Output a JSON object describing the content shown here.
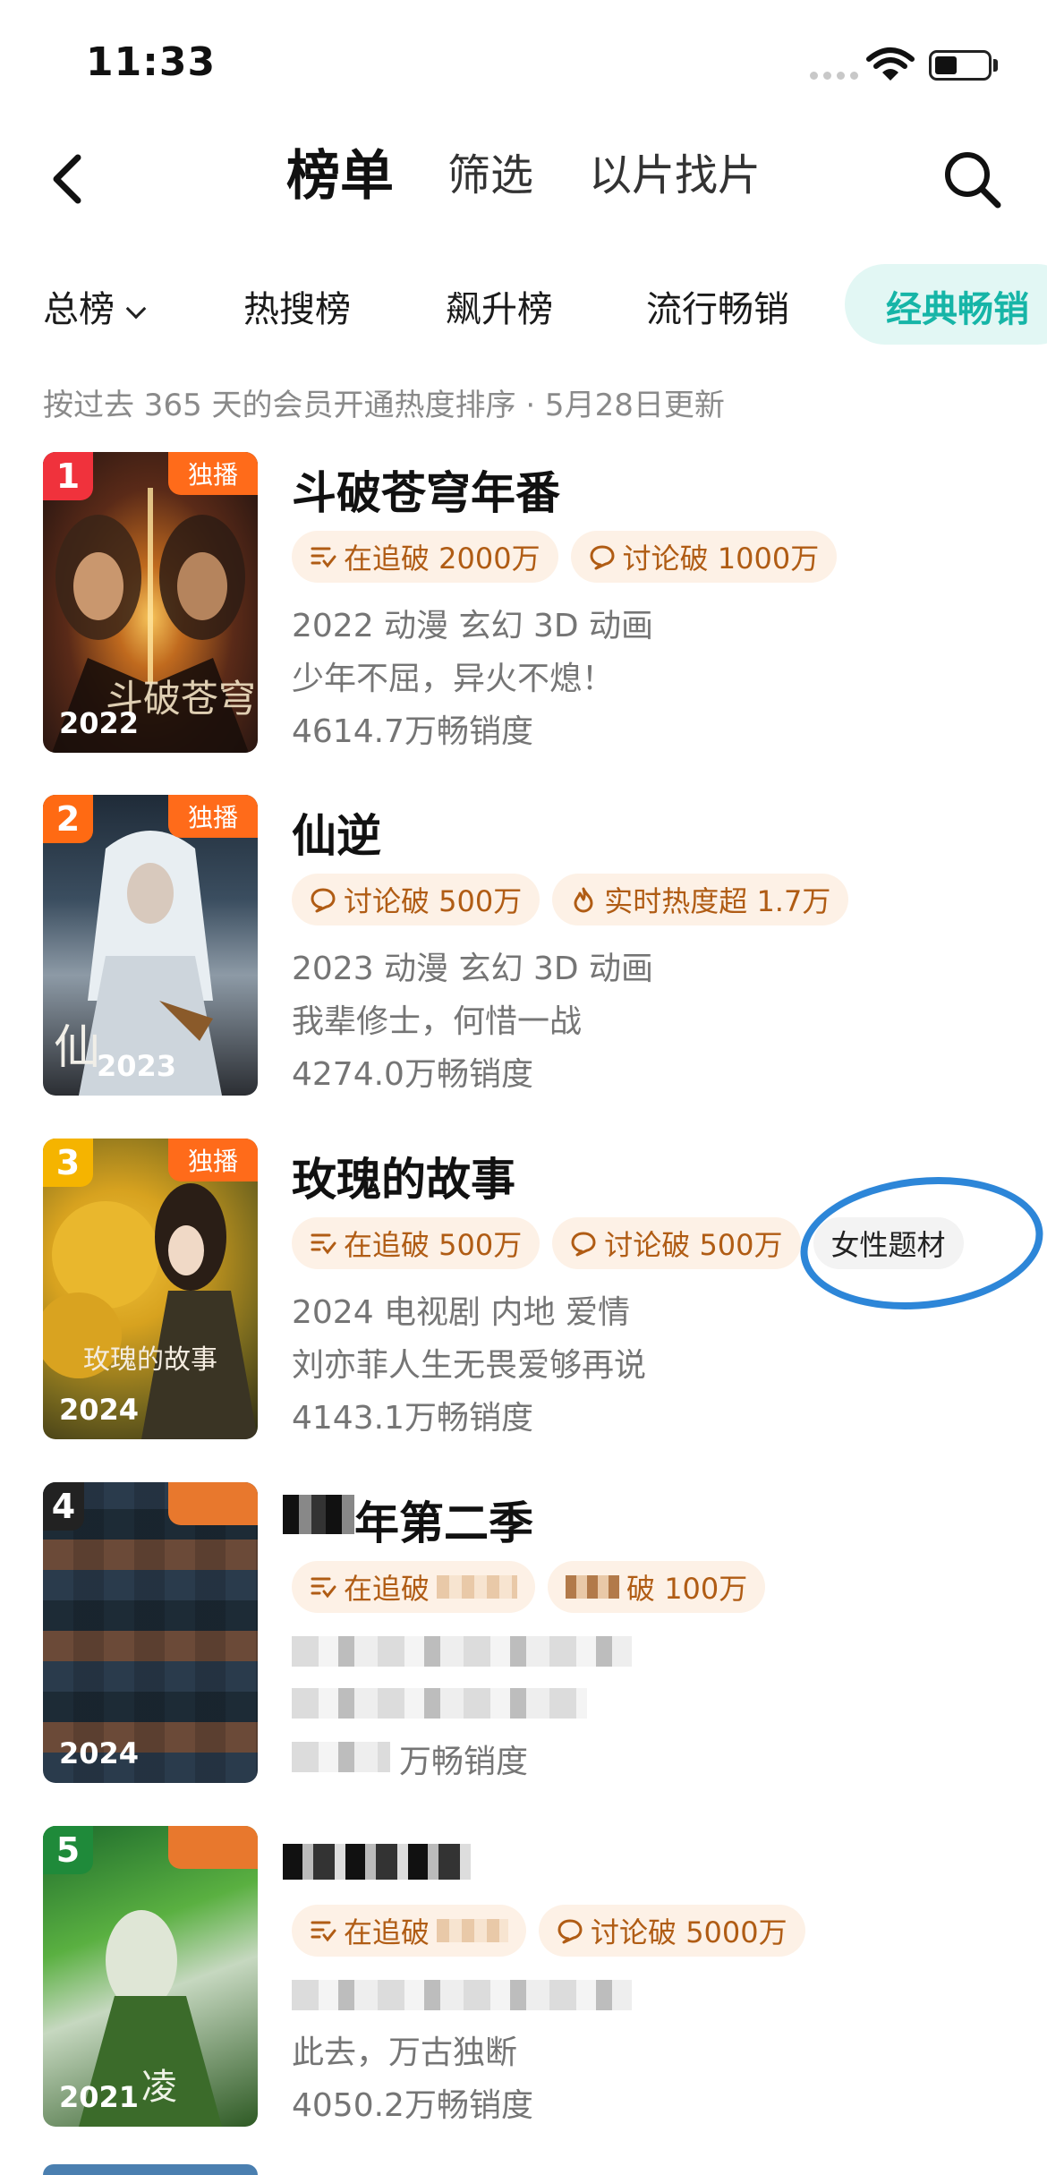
{
  "status_bar": {
    "time": "11:33"
  },
  "nav": {
    "tabs": [
      "榜单",
      "筛选",
      "以片找片"
    ]
  },
  "categories": {
    "items": [
      "总榜",
      "热搜榜",
      "飙升榜",
      "流行畅销"
    ],
    "active": "经典畅销"
  },
  "notice": "按过去 365 天的会员开通热度排序 · 5月28日更新",
  "items": [
    {
      "rank": "1",
      "badge": "独播",
      "poster_year": "2022",
      "title": "斗破苍穹年番",
      "tags": [
        {
          "icon": "following-icon",
          "label": "在追破 2000万"
        },
        {
          "icon": "comment-icon",
          "label": "讨论破 1000万"
        }
      ],
      "info": "2022 动漫 玄幻 3D 动画",
      "tagline": "少年不屈，异火不熄！",
      "sales": "4614.7万畅销度"
    },
    {
      "rank": "2",
      "badge": "独播",
      "poster_year": "2023",
      "title": "仙逆",
      "tags": [
        {
          "icon": "comment-icon",
          "label": "讨论破 500万"
        },
        {
          "icon": "flame-icon",
          "label": "实时热度超 1.7万"
        }
      ],
      "info": "2023 动漫 玄幻 3D 动画",
      "tagline": "我辈修士，何惜一战",
      "sales": "4274.0万畅销度"
    },
    {
      "rank": "3",
      "badge": "独播",
      "poster_year": "2024",
      "poster_caption": "玫瑰的故事",
      "title": "玫瑰的故事",
      "tags": [
        {
          "icon": "following-icon",
          "label": "在追破 500万"
        },
        {
          "icon": "comment-icon",
          "label": "讨论破 500万"
        }
      ],
      "extra_tag": "女性题材",
      "info": "2024 电视剧 内地 爱情",
      "tagline": "刘亦菲人生无畏爱够再说",
      "sales": "4143.1万畅销度"
    },
    {
      "rank": "4",
      "poster_year": "2024",
      "title": "年第二季",
      "tags": [
        {
          "icon": "following-icon",
          "label": "在追破"
        },
        {
          "icon": "comment-icon",
          "label": "破 100万"
        }
      ],
      "sales": "万畅销度"
    },
    {
      "rank": "5",
      "poster_year": "2021",
      "tags": [
        {
          "icon": "following-icon",
          "label": "在追破"
        },
        {
          "icon": "comment-icon",
          "label": "讨论破 5000万"
        }
      ],
      "tagline": "此去，万古独断",
      "sales": "4050.2万畅销度"
    }
  ],
  "colors": {
    "accent": "#16b5a7",
    "rank_1": "#f0323c",
    "rank_2": "#ff6a13",
    "rank_3": "#f5b400",
    "tag_bg": "#fdf1e6",
    "tag_text": "#b05c14",
    "annotation_circle": "#2d86d8"
  }
}
